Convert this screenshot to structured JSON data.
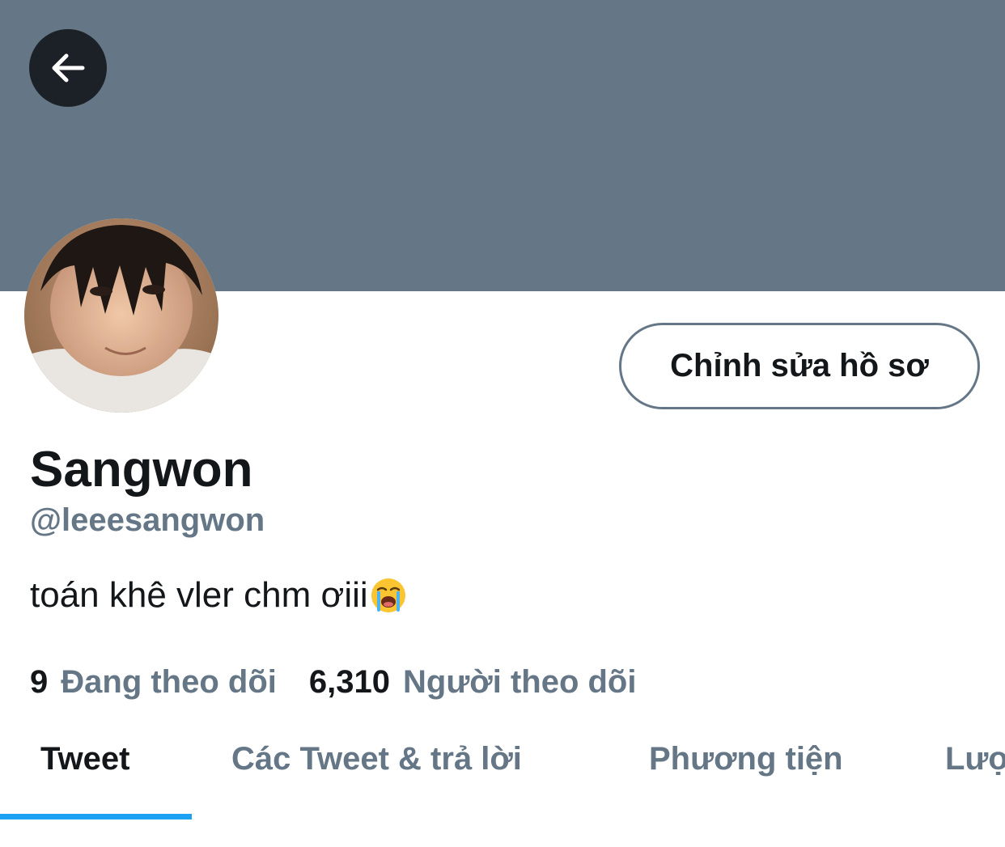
{
  "colors": {
    "banner": "#657786",
    "accent": "#1da1f2",
    "text_primary": "#14171a",
    "text_secondary": "#657786",
    "back_button_bg": "#1c2127"
  },
  "header": {
    "back_icon": "arrow-left-icon"
  },
  "profile": {
    "edit_button_label": "Chỉnh sửa hồ sơ",
    "display_name": "Sangwon",
    "handle": "@leeesangwon",
    "bio_text": "toán khê vler chm ơiii",
    "bio_emoji": "loudly-crying-face-emoji"
  },
  "stats": {
    "following_count": "9",
    "following_label": "Đang theo dõi",
    "followers_count": "6,310",
    "followers_label": "Người theo dõi"
  },
  "tabs": [
    {
      "label": "Tweet",
      "active": true
    },
    {
      "label": "Các Tweet & trả lời",
      "active": false
    },
    {
      "label": "Phương tiện",
      "active": false
    },
    {
      "label": "Lượt thích",
      "active": false
    }
  ]
}
